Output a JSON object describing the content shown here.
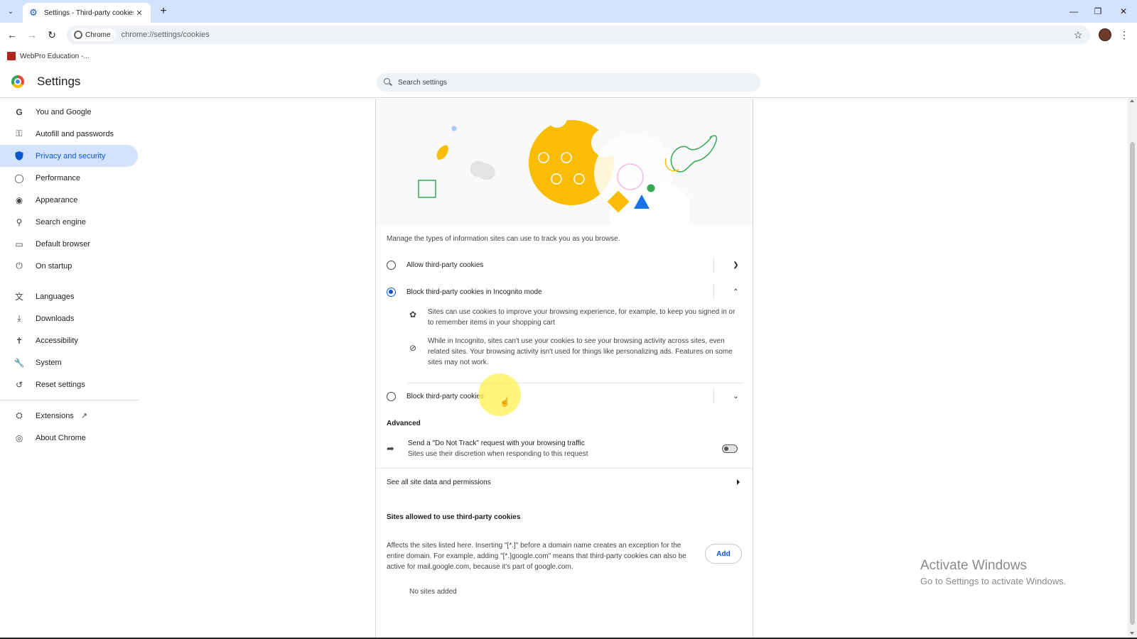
{
  "browser": {
    "tab_title": "Settings - Third-party cookies",
    "omnibox_chip": "Chrome",
    "url": "chrome://settings/cookies",
    "bookmark": "WebPro Education -..."
  },
  "settings": {
    "title": "Settings",
    "search_placeholder": "Search settings"
  },
  "sidebar": {
    "items": [
      {
        "label": "You and Google",
        "icon": "google-icon"
      },
      {
        "label": "Autofill and passwords",
        "icon": "key-icon"
      },
      {
        "label": "Privacy and security",
        "icon": "shield-icon",
        "active": true
      },
      {
        "label": "Performance",
        "icon": "speedometer-icon"
      },
      {
        "label": "Appearance",
        "icon": "palette-icon"
      },
      {
        "label": "Search engine",
        "icon": "search-icon"
      },
      {
        "label": "Default browser",
        "icon": "browser-window-icon"
      },
      {
        "label": "On startup",
        "icon": "power-icon"
      },
      {
        "label": "Languages",
        "icon": "translate-icon"
      },
      {
        "label": "Downloads",
        "icon": "download-icon"
      },
      {
        "label": "Accessibility",
        "icon": "accessibility-icon"
      },
      {
        "label": "System",
        "icon": "wrench-icon"
      },
      {
        "label": "Reset settings",
        "icon": "reset-icon"
      },
      {
        "label": "Extensions",
        "icon": "puzzle-icon"
      },
      {
        "label": "About Chrome",
        "icon": "chrome-icon"
      }
    ]
  },
  "cookies": {
    "intro": "Manage the types of information sites can use to track you as you browse.",
    "options": [
      {
        "label": "Allow third-party cookies",
        "selected": false,
        "expanded": false
      },
      {
        "label": "Block third-party cookies in Incognito mode",
        "selected": true,
        "expanded": true
      },
      {
        "label": "Block third-party cookies",
        "selected": false,
        "expanded": false
      }
    ],
    "details": [
      "Sites can use cookies to improve your browsing experience, for example, to keep you signed in or to remember items in your shopping cart",
      "While in Incognito, sites can't use your cookies to see your browsing activity across sites, even related sites. Your browsing activity isn't used for things like personalizing ads. Features on some sites may not work."
    ],
    "advanced_label": "Advanced",
    "dnt_title": "Send a \"Do Not Track\" request with your browsing traffic",
    "dnt_subtitle": "Sites use their discretion when responding to this request",
    "dnt_enabled": false,
    "see_all_label": "See all site data and permissions",
    "allowed_heading": "Sites allowed to use third-party cookies",
    "allowed_desc": "Affects the sites listed here. Inserting \"[*.]\" before a domain name creates an exception for the entire domain. For example, adding \"[*.]google.com\" means that third-party cookies can also be active for mail.google.com, because it's part of google.com.",
    "add_label": "Add",
    "no_sites": "No sites added"
  },
  "watermark": {
    "title": "Activate Windows",
    "subtitle": "Go to Settings to activate Windows."
  },
  "colors": {
    "accent": "#0b57d0",
    "active_nav_bg": "#d3e3fd",
    "tabstrip_bg": "#d3e3fd"
  }
}
